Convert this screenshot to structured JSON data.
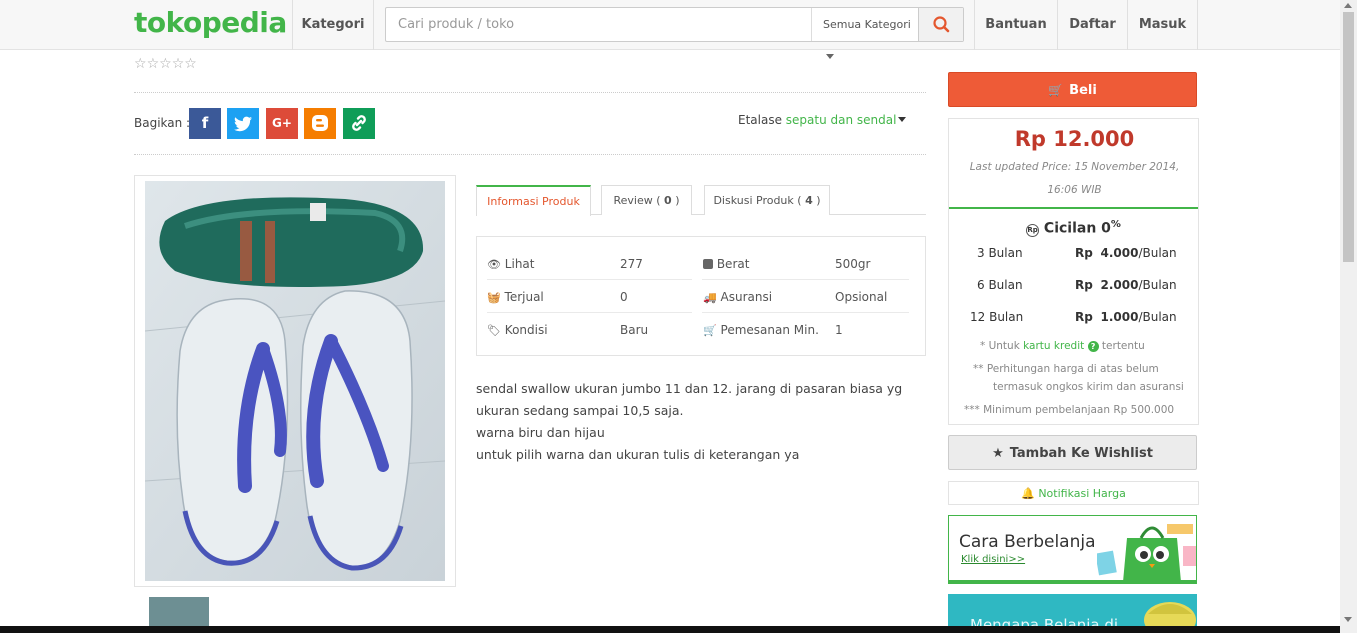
{
  "header": {
    "logo": "tokopedia",
    "kategori": "Kategori",
    "search_placeholder": "Cari produk / toko",
    "search_category": "Semua Kategori",
    "nav": [
      "Bantuan",
      "Daftar",
      "Masuk"
    ]
  },
  "rating": {
    "stars_filled": 0,
    "stars_total": 5
  },
  "share": {
    "label": "Bagikan :",
    "buttons": [
      "facebook",
      "twitter",
      "google-plus",
      "blogger",
      "copy-link"
    ],
    "colors": {
      "facebook": "#3b5998",
      "twitter": "#1da1f2",
      "google-plus": "#dd4b39",
      "blogger": "#f57d00",
      "copy-link": "#0f9d58"
    }
  },
  "etalase": {
    "label": "Etalase",
    "value": "sepatu dan sendal"
  },
  "tabs": [
    {
      "label": "Informasi Produk",
      "active": true
    },
    {
      "label": "Review",
      "count": "0"
    },
    {
      "label": "Diskusi Produk",
      "count": "4"
    }
  ],
  "info": {
    "lihat": {
      "label": "Lihat",
      "value": "277"
    },
    "berat": {
      "label": "Berat",
      "value": "500gr"
    },
    "terjual": {
      "label": "Terjual",
      "value": "0"
    },
    "asuransi": {
      "label": "Asuransi",
      "value": "Opsional"
    },
    "kondisi": {
      "label": "Kondisi",
      "value": "Baru"
    },
    "pemesanan": {
      "label": "Pemesanan Min.",
      "value": "1"
    }
  },
  "description": [
    "sendal swallow ukuran jumbo 11 dan 12. jarang di pasaran biasa yg ukuran sedang sampai 10,5 saja.",
    "warna biru dan hijau",
    "untuk pilih warna dan ukuran tulis di keterangan ya"
  ],
  "buy": {
    "label": "Beli",
    "price": "Rp 12.000",
    "updated": "Last updated Price: 15 November 2014, 16:06 WIB"
  },
  "cicilan": {
    "title": "Cicilan 0",
    "title_sup": "%",
    "rows": [
      {
        "months": "3 Bulan",
        "currency": "Rp",
        "amount": "4.000",
        "unit": "/Bulan"
      },
      {
        "months": "6 Bulan",
        "currency": "Rp",
        "amount": "2.000",
        "unit": "/Bulan"
      },
      {
        "months": "12 Bulan",
        "currency": "Rp",
        "amount": "1.000",
        "unit": "/Bulan"
      }
    ],
    "note1_mark": "*",
    "note1_a": "Untuk",
    "note1_link": "kartu kredit",
    "note1_b": "tertentu",
    "note2_mark": "**",
    "note2_line1": "Perhitungan harga di atas belum",
    "note2_line2": "termasuk ongkos kirim dan asuransi",
    "note3_mark": "***",
    "note3": "Minimum pembelanjaan Rp 500.000"
  },
  "wishlist": "Tambah Ke Wishlist",
  "notifikasi": "Notifikasi Harga",
  "banner1": {
    "title": "Cara Berbelanja",
    "link": "Klik disini>>"
  },
  "banner2": {
    "title": "Mengapa Belanja di"
  },
  "accent_color": "#42b549",
  "buy_color": "#ee5b37"
}
